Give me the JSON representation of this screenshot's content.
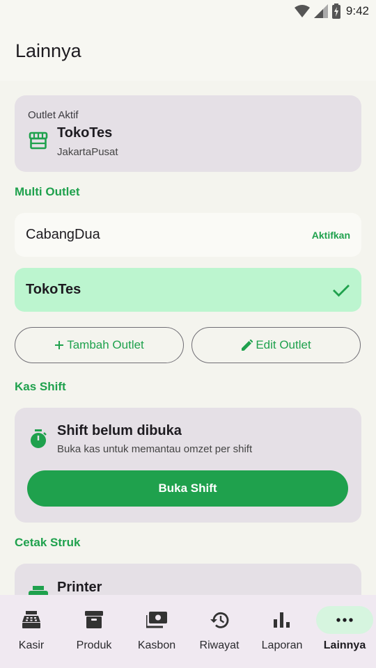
{
  "status_bar": {
    "time": "9:42",
    "icons": [
      "wifi-icon",
      "signal-icon",
      "battery-charging-icon"
    ]
  },
  "header": {
    "title": "Lainnya"
  },
  "active_outlet": {
    "overline": "Outlet Aktif",
    "name": "TokoTes",
    "location": "JakartaPusat",
    "icon": "store-icon"
  },
  "multi_outlet": {
    "section_title": "Multi Outlet",
    "outlets": [
      {
        "name": "CabangDua",
        "action": "Aktifkan",
        "selected": false
      },
      {
        "name": "TokoTes",
        "action": "",
        "selected": true
      }
    ],
    "add_button": "Tambah Outlet",
    "edit_button": "Edit Outlet"
  },
  "cash_shift": {
    "section_title": "Kas Shift",
    "title": "Shift belum dibuka",
    "subtitle": "Buka kas untuk memantau omzet per shift",
    "button": "Buka Shift",
    "icon": "timer-icon"
  },
  "print_receipt": {
    "section_title": "Cetak Struk",
    "title": "Printer",
    "icon": "printer-icon"
  },
  "bottom_nav": {
    "items": [
      {
        "label": "Kasir",
        "icon": "cash-register-icon",
        "active": false
      },
      {
        "label": "Produk",
        "icon": "archive-box-icon",
        "active": false
      },
      {
        "label": "Kasbon",
        "icon": "payments-icon",
        "active": false
      },
      {
        "label": "Riwayat",
        "icon": "history-icon",
        "active": false
      },
      {
        "label": "Laporan",
        "icon": "bar-chart-icon",
        "active": false
      },
      {
        "label": "Lainnya",
        "icon": "more-horiz-icon",
        "active": true
      }
    ]
  },
  "colors": {
    "accent": "#1fa14d",
    "selected_row": "#bcf5cf",
    "card": "#e5e0e6",
    "background": "#f4f4ee"
  }
}
